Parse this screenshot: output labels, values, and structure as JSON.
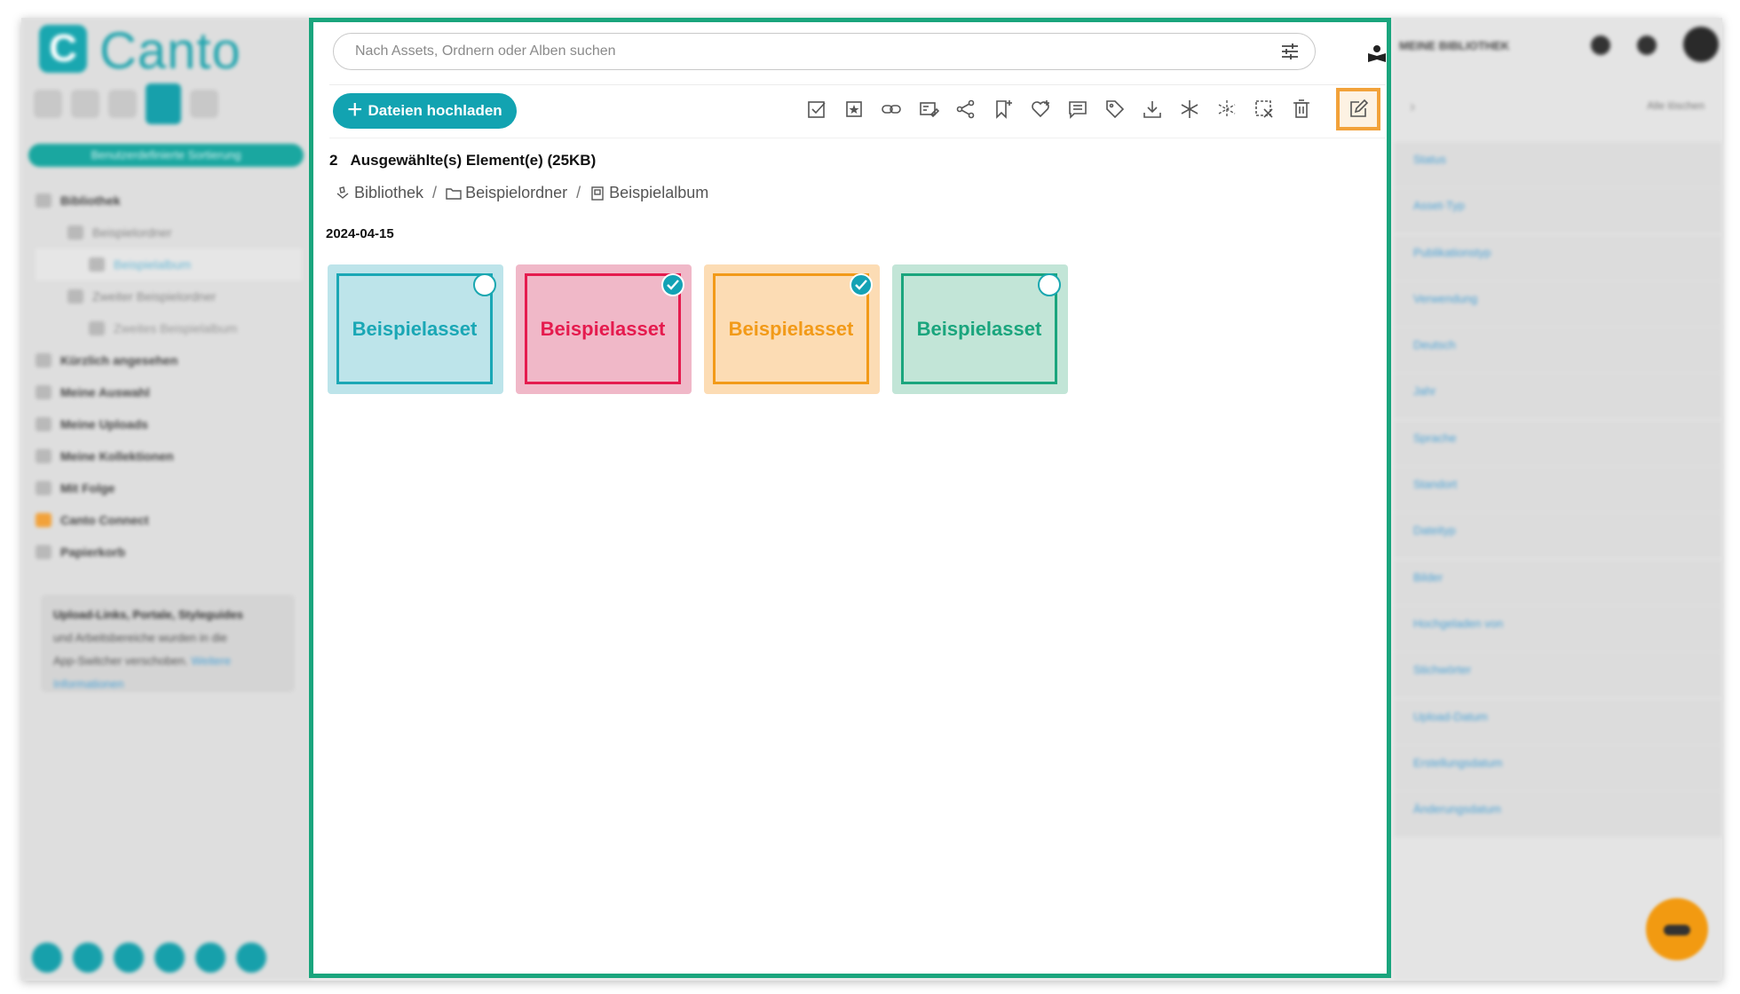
{
  "app": {
    "name": "Canto"
  },
  "sidebar": {
    "section_label": "Benutzerdefinierte Sortierung",
    "items": [
      {
        "label": "Bibliothek"
      },
      {
        "label": "Beispielordner"
      },
      {
        "label": "Beispielalbum"
      },
      {
        "label": "Zweiter Beispielordner"
      },
      {
        "label": "Zweites Beispielalbum"
      },
      {
        "label": "Kürzlich angesehen"
      },
      {
        "label": "Meine Auswahl"
      },
      {
        "label": "Meine Uploads"
      },
      {
        "label": "Meine Kollektionen"
      },
      {
        "label": "Mit Folge"
      },
      {
        "label": "Canto Connect"
      },
      {
        "label": "Papierkorb"
      }
    ],
    "note": {
      "line1": "Upload-Links, Portale, Styleguides",
      "line2": "und Arbeitsbereiche wurden in die",
      "line3": "App-Switcher verschoben.",
      "link": "Weitere Informationen"
    }
  },
  "right_panel": {
    "library_label": "MEINE BIBLIOTHEK",
    "clear_label": "Alle löschen",
    "filters": [
      "Status",
      "Asset-Typ",
      "Publikationstyp",
      "Verwendung",
      "Deutsch",
      "Jahr",
      "Sprache",
      "Standort",
      "Dateityp",
      "Bilder",
      "Hochgeladen von",
      "Stichwörter",
      "Upload-Datum",
      "Erstellungsdatum",
      "Änderungsdatum"
    ]
  },
  "main": {
    "search": {
      "placeholder": "Nach Assets, Ordnern oder Alben suchen"
    },
    "upload_button": "Dateien hochladen",
    "selection": {
      "count": "2",
      "label": "Ausgewählte(s) Element(e) (25KB)"
    },
    "breadcrumb": [
      {
        "label": "Bibliothek"
      },
      {
        "label": "Beispielordner"
      },
      {
        "label": "Beispielalbum"
      }
    ],
    "date": "2024-04-15",
    "assets": [
      {
        "label": "Beispielasset",
        "selected": false,
        "bg": "#bde4ea",
        "color": "#1aa7b5"
      },
      {
        "label": "Beispielasset",
        "selected": true,
        "bg": "#f0b8c8",
        "color": "#e51b4e"
      },
      {
        "label": "Beispielasset",
        "selected": true,
        "bg": "#fcdcb4",
        "color": "#f29a18"
      },
      {
        "label": "Beispielasset",
        "selected": false,
        "bg": "#c2e5d7",
        "color": "#1aa57d"
      }
    ]
  },
  "colors": {
    "accent": "#12a3b1",
    "highlight": "#f2a23a",
    "focus_border": "#1aa57d"
  }
}
